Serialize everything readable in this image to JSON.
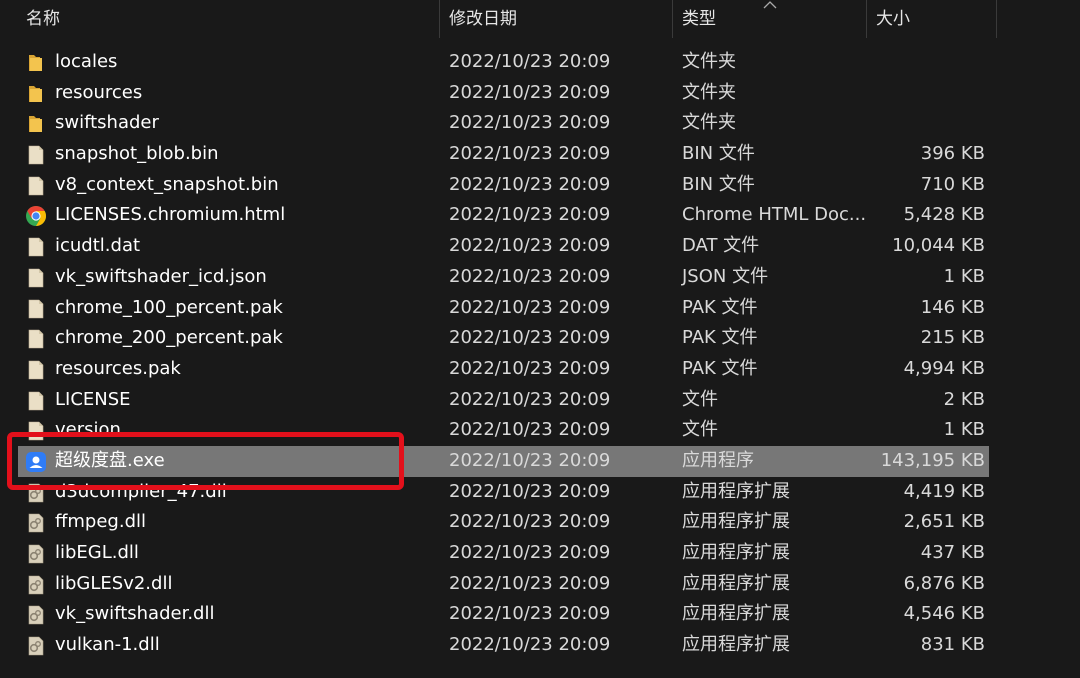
{
  "header": {
    "name": "名称",
    "date": "修改日期",
    "type": "类型",
    "size": "大小"
  },
  "files": [
    {
      "name": "locales",
      "date": "2022/10/23 20:09",
      "type": "文件夹",
      "size": "",
      "icon": "folder-icon"
    },
    {
      "name": "resources",
      "date": "2022/10/23 20:09",
      "type": "文件夹",
      "size": "",
      "icon": "folder-icon"
    },
    {
      "name": "swiftshader",
      "date": "2022/10/23 20:09",
      "type": "文件夹",
      "size": "",
      "icon": "folder-icon"
    },
    {
      "name": "snapshot_blob.bin",
      "date": "2022/10/23 20:09",
      "type": "BIN 文件",
      "size": "396 KB",
      "icon": "file-icon"
    },
    {
      "name": "v8_context_snapshot.bin",
      "date": "2022/10/23 20:09",
      "type": "BIN 文件",
      "size": "710 KB",
      "icon": "file-icon"
    },
    {
      "name": "LICENSES.chromium.html",
      "date": "2022/10/23 20:09",
      "type": "Chrome HTML Doc...",
      "size": "5,428 KB",
      "icon": "chrome-icon"
    },
    {
      "name": "icudtl.dat",
      "date": "2022/10/23 20:09",
      "type": "DAT 文件",
      "size": "10,044 KB",
      "icon": "file-icon"
    },
    {
      "name": "vk_swiftshader_icd.json",
      "date": "2022/10/23 20:09",
      "type": "JSON 文件",
      "size": "1 KB",
      "icon": "file-icon"
    },
    {
      "name": "chrome_100_percent.pak",
      "date": "2022/10/23 20:09",
      "type": "PAK 文件",
      "size": "146 KB",
      "icon": "file-icon"
    },
    {
      "name": "chrome_200_percent.pak",
      "date": "2022/10/23 20:09",
      "type": "PAK 文件",
      "size": "215 KB",
      "icon": "file-icon"
    },
    {
      "name": "resources.pak",
      "date": "2022/10/23 20:09",
      "type": "PAK 文件",
      "size": "4,994 KB",
      "icon": "file-icon"
    },
    {
      "name": "LICENSE",
      "date": "2022/10/23 20:09",
      "type": "文件",
      "size": "2 KB",
      "icon": "file-icon"
    },
    {
      "name": "version",
      "date": "2022/10/23 20:09",
      "type": "文件",
      "size": "1 KB",
      "icon": "file-icon"
    },
    {
      "name": "超级度盘.exe",
      "date": "2022/10/23 20:09",
      "type": "应用程序",
      "size": "143,195 KB",
      "icon": "app-exe-icon",
      "selected": true
    },
    {
      "name": "d3dcompiler_47.dll",
      "date": "2022/10/23 20:09",
      "type": "应用程序扩展",
      "size": "4,419 KB",
      "icon": "dll-icon"
    },
    {
      "name": "ffmpeg.dll",
      "date": "2022/10/23 20:09",
      "type": "应用程序扩展",
      "size": "2,651 KB",
      "icon": "dll-icon"
    },
    {
      "name": "libEGL.dll",
      "date": "2022/10/23 20:09",
      "type": "应用程序扩展",
      "size": "437 KB",
      "icon": "dll-icon"
    },
    {
      "name": "libGLESv2.dll",
      "date": "2022/10/23 20:09",
      "type": "应用程序扩展",
      "size": "6,876 KB",
      "icon": "dll-icon"
    },
    {
      "name": "vk_swiftshader.dll",
      "date": "2022/10/23 20:09",
      "type": "应用程序扩展",
      "size": "4,546 KB",
      "icon": "dll-icon"
    },
    {
      "name": "vulkan-1.dll",
      "date": "2022/10/23 20:09",
      "type": "应用程序扩展",
      "size": "831 KB",
      "icon": "dll-icon"
    }
  ],
  "colors": {
    "background": "#191919",
    "selection": "#777777",
    "highlight_border": "#e3101b",
    "folder": "#f3c44e",
    "file": "#eadfc6"
  }
}
